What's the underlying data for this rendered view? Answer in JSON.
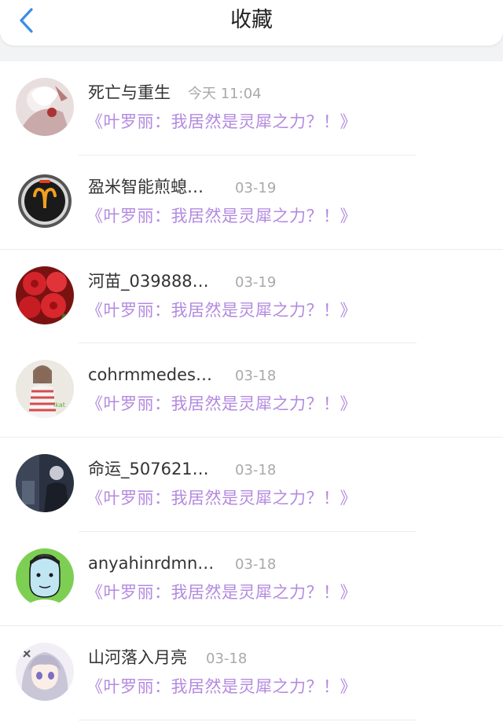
{
  "header": {
    "title": "收藏",
    "back_icon": "chevron-left-icon",
    "accent_color": "#3a8ee6"
  },
  "items": [
    {
      "name": "死亡与重生",
      "time": "今天 11:04",
      "title": "《叶罗丽：我居然是灵犀之力？！》",
      "avatar": "anime-girl-avatar"
    },
    {
      "name": "盈米智能煎螅…",
      "time": "03-19",
      "title": "《叶罗丽：我居然是灵犀之力？！》",
      "avatar": "aries-badge-avatar"
    },
    {
      "name": "河苗_039888…",
      "time": "03-19",
      "title": "《叶罗丽：我居然是灵犀之力？！》",
      "avatar": "red-roses-avatar"
    },
    {
      "name": "cohrmmedes…",
      "time": "03-18",
      "title": "《叶罗丽：我居然是灵犀之力？！》",
      "avatar": "striped-girl-avatar"
    },
    {
      "name": "命运_507621…",
      "time": "03-18",
      "title": "《叶罗丽：我居然是灵犀之力？！》",
      "avatar": "dark-photo-avatar"
    },
    {
      "name": "anyahinrdmn…",
      "time": "03-18",
      "title": "《叶罗丽：我居然是灵犀之力？！》",
      "avatar": "cartoon-face-avatar"
    },
    {
      "name": "山河落入月亮",
      "time": "03-18",
      "title": "《叶罗丽：我居然是灵犀之力？！》",
      "avatar": "anime-silver-hair-avatar"
    }
  ],
  "colors": {
    "name": "#333333",
    "time": "#a9a9a9",
    "book_title": "#b38ae0"
  }
}
